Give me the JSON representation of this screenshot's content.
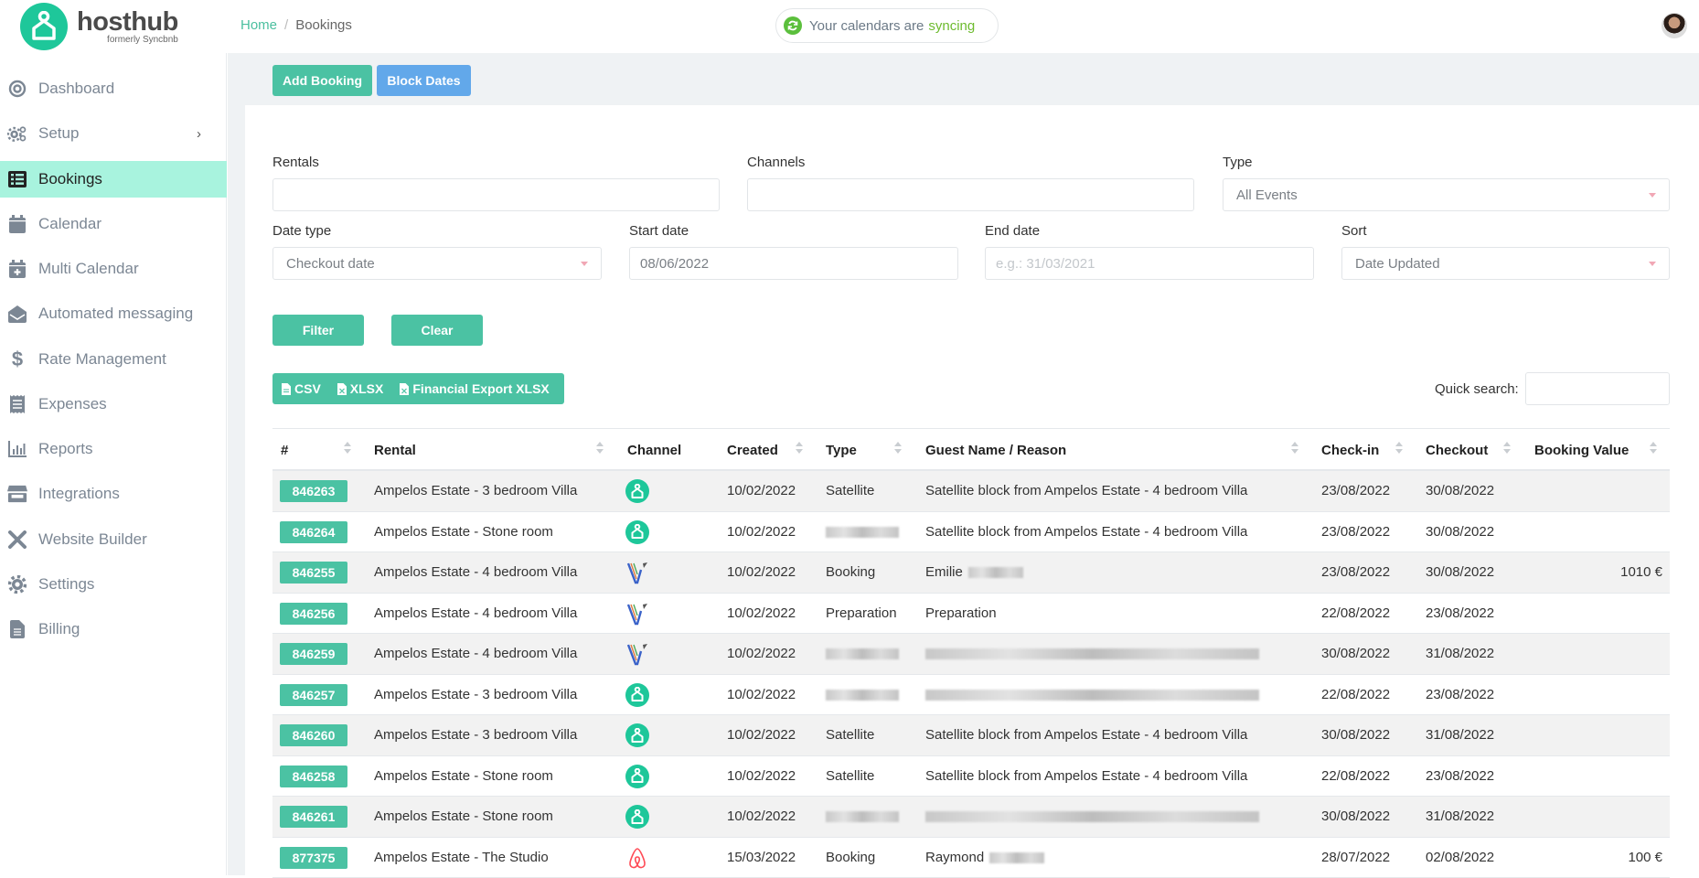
{
  "app": {
    "name": "hosthub",
    "subtitle": "formerly Syncbnb",
    "accent": "#4bc2a3",
    "brand": "#1ec79a"
  },
  "breadcrumb": {
    "home": "Home",
    "separator": "/",
    "current": "Bookings"
  },
  "sync": {
    "prefix": "Your calendars are",
    "status": "syncing"
  },
  "sidebar": {
    "items": [
      {
        "label": "Dashboard",
        "icon": "dashboard-icon",
        "active": false
      },
      {
        "label": "Setup",
        "icon": "gears-icon",
        "active": false,
        "has_submenu": true
      },
      {
        "label": "Bookings",
        "icon": "list-icon",
        "active": true
      },
      {
        "label": "Calendar",
        "icon": "calendar-icon",
        "active": false
      },
      {
        "label": "Multi Calendar",
        "icon": "calendar-plus-icon",
        "active": false
      },
      {
        "label": "Automated messaging",
        "icon": "envelope-open-icon",
        "active": false
      },
      {
        "label": "Rate Management",
        "icon": "dollar-icon",
        "active": false
      },
      {
        "label": "Expenses",
        "icon": "receipt-icon",
        "active": false
      },
      {
        "label": "Reports",
        "icon": "bar-chart-icon",
        "active": false
      },
      {
        "label": "Integrations",
        "icon": "store-icon",
        "active": false
      },
      {
        "label": "Website Builder",
        "icon": "tools-icon",
        "active": false
      },
      {
        "label": "Settings",
        "icon": "gear-icon",
        "active": false
      },
      {
        "label": "Billing",
        "icon": "file-icon",
        "active": false
      }
    ]
  },
  "actions": {
    "add_booking": "Add Booking",
    "block_dates": "Block Dates"
  },
  "filters": {
    "rentals": {
      "label": "Rentals",
      "value": ""
    },
    "channels": {
      "label": "Channels",
      "value": ""
    },
    "type": {
      "label": "Type",
      "value": "All Events"
    },
    "date_type": {
      "label": "Date type",
      "value": "Checkout date"
    },
    "start_date": {
      "label": "Start date",
      "value": "08/06/2022"
    },
    "end_date": {
      "label": "End date",
      "value": "",
      "placeholder": "e.g.: 31/03/2021"
    },
    "sort": {
      "label": "Sort",
      "value": "Date Updated"
    },
    "filter_button": "Filter",
    "clear_button": "Clear"
  },
  "exports": {
    "csv": "CSV",
    "xlsx": "XLSX",
    "financial": "Financial Export XLSX"
  },
  "quick_search": {
    "label": "Quick search:",
    "value": ""
  },
  "table": {
    "columns": [
      "#",
      "Rental",
      "Channel",
      "Created",
      "Type",
      "Guest Name / Reason",
      "Check-in",
      "Checkout",
      "Booking Value"
    ],
    "rows": [
      {
        "id": "846263",
        "rental": "Ampelos Estate - 3 bedroom Villa",
        "channel": "hosthub",
        "created": "10/02/2022",
        "type": "Satellite",
        "guest": "Satellite block from Ampelos Estate - 4 bedroom Villa",
        "checkin": "23/08/2022",
        "checkout": "30/08/2022",
        "value": ""
      },
      {
        "id": "846264",
        "rental": "Ampelos Estate - Stone room",
        "channel": "hosthub",
        "created": "10/02/2022",
        "type": "[blurred]",
        "guest": "Satellite block from Ampelos Estate - 4 bedroom Villa",
        "checkin": "23/08/2022",
        "checkout": "30/08/2022",
        "value": ""
      },
      {
        "id": "846255",
        "rental": "Ampelos Estate - 4 bedroom Villa",
        "channel": "vrbo",
        "created": "10/02/2022",
        "type": "Booking",
        "guest": "Emilie",
        "guest_blurred": true,
        "checkin": "23/08/2022",
        "checkout": "30/08/2022",
        "value": "1010 €"
      },
      {
        "id": "846256",
        "rental": "Ampelos Estate - 4 bedroom Villa",
        "channel": "vrbo",
        "created": "10/02/2022",
        "type": "Preparation",
        "guest": "Preparation",
        "checkin": "22/08/2022",
        "checkout": "23/08/2022",
        "value": ""
      },
      {
        "id": "846259",
        "rental": "Ampelos Estate - 4 bedroom Villa",
        "channel": "vrbo",
        "created": "10/02/2022",
        "type": "[blurred]",
        "guest": "[blurred]",
        "checkin": "30/08/2022",
        "checkout": "31/08/2022",
        "value": ""
      },
      {
        "id": "846257",
        "rental": "Ampelos Estate - 3 bedroom Villa",
        "channel": "hosthub",
        "created": "10/02/2022",
        "type": "[blurred]",
        "guest": "[blurred]",
        "checkin": "22/08/2022",
        "checkout": "23/08/2022",
        "value": ""
      },
      {
        "id": "846260",
        "rental": "Ampelos Estate - 3 bedroom Villa",
        "channel": "hosthub",
        "created": "10/02/2022",
        "type": "Satellite",
        "guest": "Satellite block from Ampelos Estate - 4 bedroom Villa",
        "checkin": "30/08/2022",
        "checkout": "31/08/2022",
        "value": ""
      },
      {
        "id": "846258",
        "rental": "Ampelos Estate - Stone room",
        "channel": "hosthub",
        "created": "10/02/2022",
        "type": "Satellite",
        "guest": "Satellite block from Ampelos Estate - 4 bedroom Villa",
        "checkin": "22/08/2022",
        "checkout": "23/08/2022",
        "value": ""
      },
      {
        "id": "846261",
        "rental": "Ampelos Estate - Stone room",
        "channel": "hosthub",
        "created": "10/02/2022",
        "type": "[blurred]",
        "guest": "[blurred]",
        "checkin": "30/08/2022",
        "checkout": "31/08/2022",
        "value": ""
      },
      {
        "id": "877375",
        "rental": "Ampelos Estate - The Studio",
        "channel": "airbnb",
        "created": "15/03/2022",
        "type": "Booking",
        "guest": "Raymond",
        "guest_blurred": true,
        "checkin": "28/07/2022",
        "checkout": "02/08/2022",
        "value": "100 €"
      }
    ]
  }
}
